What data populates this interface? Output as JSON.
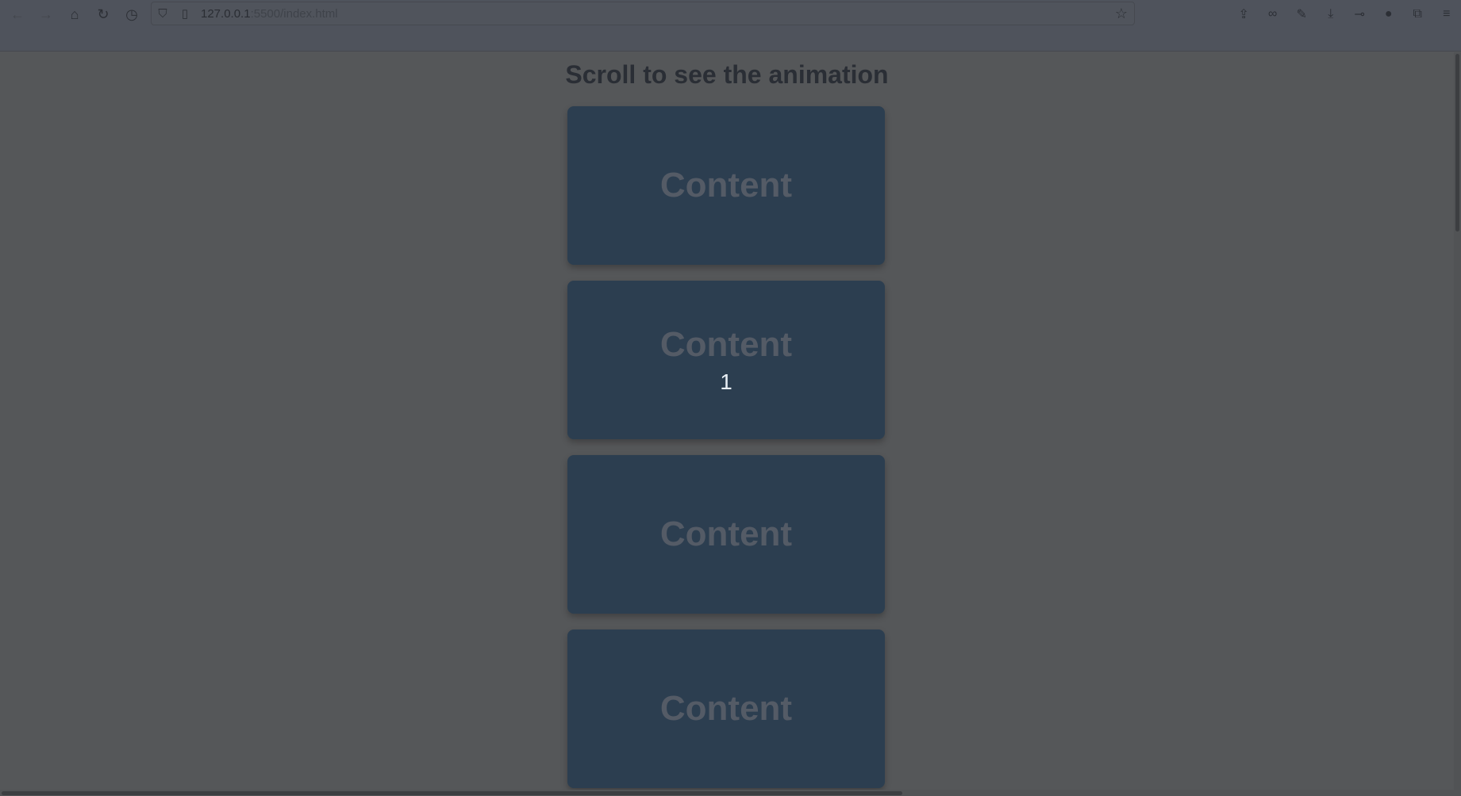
{
  "browser": {
    "url_host": "127.0.0.1",
    "url_path": ":5500/index.html"
  },
  "page": {
    "title": "Scroll to see the animation",
    "cards": [
      {
        "label": "Content",
        "counter": ""
      },
      {
        "label": "Content",
        "counter": "1"
      },
      {
        "label": "Content",
        "counter": ""
      },
      {
        "label": "Content",
        "counter": ""
      }
    ]
  },
  "colors": {
    "background": "#555759",
    "card": "#2c3e50",
    "card_text": "#545b66"
  }
}
